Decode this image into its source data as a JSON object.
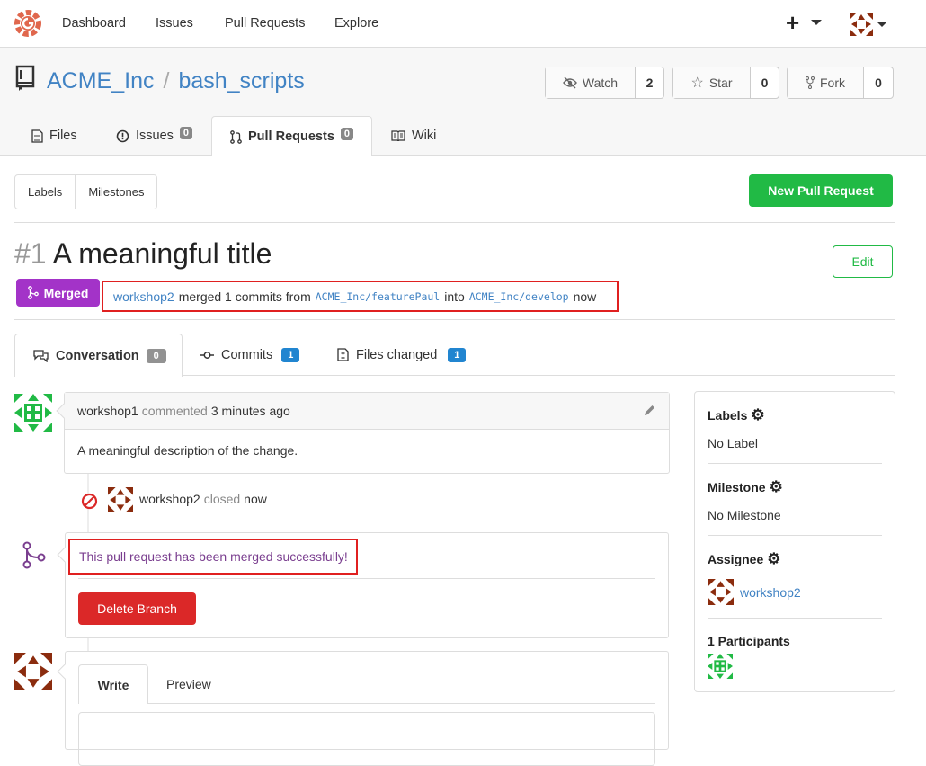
{
  "nav": {
    "links": [
      "Dashboard",
      "Issues",
      "Pull Requests",
      "Explore"
    ],
    "plus": "+"
  },
  "repo": {
    "owner": "ACME_Inc",
    "separator": "/",
    "name": "bash_scripts",
    "watch": {
      "label": "Watch",
      "count": "2"
    },
    "star": {
      "label": "Star",
      "count": "0"
    },
    "fork": {
      "label": "Fork",
      "count": "0"
    },
    "tabs": [
      {
        "label": "Files"
      },
      {
        "label": "Issues",
        "badge": "0"
      },
      {
        "label": "Pull Requests",
        "badge": "0"
      },
      {
        "label": "Wiki"
      }
    ]
  },
  "toolbar": {
    "labels": "Labels",
    "milestones": "Milestones",
    "new_pr": "New Pull Request"
  },
  "pr": {
    "number": "#1",
    "title": "A meaningful title",
    "edit": "Edit",
    "status": "Merged",
    "merge_user": "workshop2",
    "merge_text": "merged 1 commits from",
    "from_branch": "ACME_Inc/featurePaul",
    "into": "into",
    "to_branch": "ACME_Inc/develop",
    "when": "now"
  },
  "pr_tabs": [
    {
      "label": "Conversation",
      "count": "0"
    },
    {
      "label": "Commits",
      "count": "1"
    },
    {
      "label": "Files changed",
      "count": "1"
    }
  ],
  "comment": {
    "author": "workshop1",
    "action": "commented",
    "time": "3 minutes ago",
    "body": "A meaningful description of the change."
  },
  "event": {
    "user": "workshop2",
    "action": "closed",
    "time": "now"
  },
  "merge_box": {
    "message": "This pull request has been merged successfully!",
    "delete_branch": "Delete Branch"
  },
  "editor": {
    "write": "Write",
    "preview": "Preview"
  },
  "sidebar": {
    "labels_title": "Labels",
    "labels_value": "No Label",
    "milestone_title": "Milestone",
    "milestone_value": "No Milestone",
    "assignee_title": "Assignee",
    "assignee_value": "workshop2",
    "participants_title": "1 Participants"
  },
  "colors": {
    "merged": "#a333c8",
    "green": "#21ba45",
    "red": "#db2828",
    "link": "#4183c4",
    "avatar_green": "#21ba45",
    "avatar_brown": "#8b2c0e"
  }
}
